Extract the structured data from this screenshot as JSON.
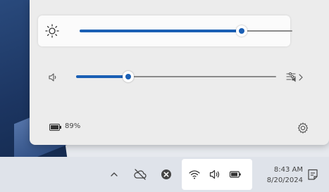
{
  "quick_settings": {
    "brightness": {
      "icon": "sun-icon",
      "level": 0.76
    },
    "volume": {
      "icon": "speaker-icon",
      "level": 0.26,
      "output_icon": "audio-output-icon"
    },
    "battery": {
      "icon": "battery-icon",
      "percent": "89%"
    },
    "settings_icon": "gear-icon"
  },
  "taskbar": {
    "tray_icons": [
      "chevron-up-icon",
      "cloud-off-icon",
      "close-circle-icon"
    ],
    "status_group_icons": [
      "wifi-icon",
      "speaker-icon",
      "battery-icon"
    ],
    "time": "8:43 AM",
    "date": "8/20/2024",
    "notification_icon": "notification-icon"
  },
  "colors": {
    "accent": "#1a5fb4",
    "panel": "#ececec",
    "taskbar": "#dfe3ea"
  }
}
